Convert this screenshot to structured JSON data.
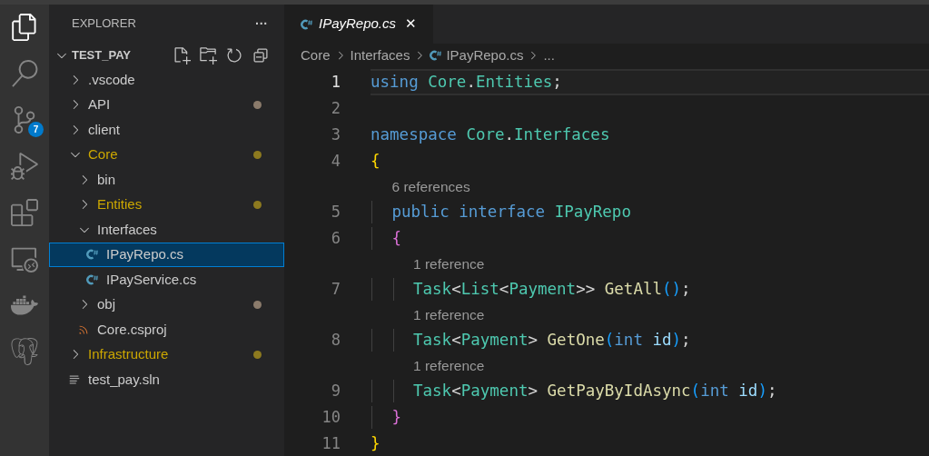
{
  "activity_bar": [
    {
      "kind": "files",
      "selected": true
    },
    {
      "kind": "search",
      "selected": false
    },
    {
      "kind": "source-control",
      "selected": false,
      "badge": "7"
    },
    {
      "kind": "debug",
      "selected": false
    },
    {
      "kind": "extensions",
      "selected": false
    },
    {
      "kind": "remote",
      "selected": false
    },
    {
      "kind": "docker",
      "selected": false
    },
    {
      "kind": "database",
      "selected": false
    }
  ],
  "sidebar": {
    "title": "EXPLORER",
    "more": "···",
    "root": {
      "name": "TEST_PAY",
      "expanded": true
    },
    "items": [
      {
        "name": ".vscode",
        "kind": "folder",
        "expanded": false,
        "modified": false,
        "selected": false
      },
      {
        "name": "API",
        "kind": "folder",
        "expanded": false,
        "modified": false,
        "selected": false,
        "color": "#8b7b6b"
      },
      {
        "name": "client",
        "kind": "folder",
        "expanded": false,
        "modified": false,
        "selected": false
      },
      {
        "name": "Core",
        "kind": "folder",
        "expanded": true,
        "modified": true,
        "selected": false,
        "color": "#8d7a1f",
        "children": [
          {
            "name": "bin",
            "kind": "folder",
            "expanded": false,
            "modified": false,
            "selected": false
          },
          {
            "name": "Entities",
            "kind": "folder",
            "expanded": false,
            "modified": true,
            "selected": false,
            "color": "#8d7a1f"
          },
          {
            "name": "Interfaces",
            "kind": "folder",
            "expanded": true,
            "modified": false,
            "selected": false,
            "children": [
              {
                "name": "IPayRepo.cs",
                "kind": "csharp",
                "modified": false,
                "selected": true
              },
              {
                "name": "IPayService.cs",
                "kind": "csharp",
                "modified": false,
                "selected": false
              }
            ]
          },
          {
            "name": "obj",
            "kind": "folder",
            "expanded": false,
            "modified": false,
            "selected": false,
            "color": "#8b7b6b"
          },
          {
            "name": "Core.csproj",
            "kind": "rss",
            "modified": false,
            "selected": false
          }
        ]
      },
      {
        "name": "Infrastructure",
        "kind": "folder",
        "expanded": false,
        "modified": true,
        "selected": false,
        "color": "#8d7a1f"
      },
      {
        "name": "test_pay.sln",
        "kind": "lines",
        "modified": false,
        "selected": false
      }
    ]
  },
  "tabs": [
    {
      "title": "IPayRepo.cs",
      "preview": true,
      "selected": true,
      "close": "✕"
    }
  ],
  "breadcrumbs": [
    {
      "label": "Core",
      "kind": "folder"
    },
    {
      "label": "Interfaces",
      "kind": "folder"
    },
    {
      "label": "IPayRepo.cs",
      "kind": "csharp"
    },
    {
      "label": "...",
      "kind": "symbol"
    }
  ],
  "lines": [
    {
      "kind": "code",
      "number": "1",
      "current": true,
      "words": [
        [
          {
            "text": "using",
            "kind": "keyword"
          }
        ],
        [
          {
            "text": "Core",
            "kind": "type"
          },
          {
            "text": ".",
            "kind": "plain"
          },
          {
            "text": "Entities",
            "kind": "type"
          },
          {
            "text": ";",
            "kind": "plain"
          }
        ]
      ]
    },
    {
      "kind": "code",
      "number": "2",
      "current": false
    },
    {
      "kind": "code",
      "number": "3",
      "current": false,
      "words": [
        [
          {
            "text": "namespace",
            "kind": "keyword"
          }
        ],
        [
          {
            "text": "Core",
            "kind": "type"
          },
          {
            "text": ".",
            "kind": "plain"
          },
          {
            "text": "Interfaces",
            "kind": "type"
          }
        ]
      ]
    },
    {
      "kind": "code",
      "number": "4",
      "current": false,
      "words": [
        [
          {
            "text": "{",
            "kind": "bracket1"
          }
        ]
      ],
      "children": [
        {
          "kind": "codelens",
          "text": "6 references"
        },
        {
          "kind": "code",
          "number": "5",
          "current": false,
          "words": [
            [
              {
                "text": "public",
                "kind": "keyword"
              }
            ],
            [
              {
                "text": "interface",
                "kind": "keyword"
              }
            ],
            [
              {
                "text": "IPayRepo",
                "kind": "type"
              }
            ]
          ]
        },
        {
          "kind": "code",
          "number": "6",
          "current": false,
          "words": [
            [
              {
                "text": "{",
                "kind": "bracket2"
              }
            ]
          ],
          "children": [
            {
              "kind": "codelens",
              "text": "1 reference"
            },
            {
              "kind": "code",
              "number": "7",
              "current": false,
              "words": [
                [
                  {
                    "text": "Task",
                    "kind": "type"
                  },
                  {
                    "text": "<",
                    "kind": "plain"
                  },
                  {
                    "text": "List",
                    "kind": "type"
                  },
                  {
                    "text": "<",
                    "kind": "plain"
                  },
                  {
                    "text": "Payment",
                    "kind": "type"
                  },
                  {
                    "text": ">>",
                    "kind": "plain"
                  }
                ],
                [
                  {
                    "text": "GetAll",
                    "kind": "func"
                  },
                  {
                    "text": "()",
                    "kind": "bracket3"
                  },
                  {
                    "text": ";",
                    "kind": "plain"
                  }
                ]
              ]
            },
            {
              "kind": "codelens",
              "text": "1 reference"
            },
            {
              "kind": "code",
              "number": "8",
              "current": false,
              "words": [
                [
                  {
                    "text": "Task",
                    "kind": "type"
                  },
                  {
                    "text": "<",
                    "kind": "plain"
                  },
                  {
                    "text": "Payment",
                    "kind": "type"
                  },
                  {
                    "text": ">",
                    "kind": "plain"
                  }
                ],
                [
                  {
                    "text": "GetOne",
                    "kind": "func"
                  },
                  {
                    "text": "(",
                    "kind": "bracket3"
                  },
                  {
                    "text": "int",
                    "kind": "keyword"
                  }
                ],
                [
                  {
                    "text": "id",
                    "kind": "param"
                  },
                  {
                    "text": ")",
                    "kind": "bracket3"
                  },
                  {
                    "text": ";",
                    "kind": "plain"
                  }
                ]
              ]
            },
            {
              "kind": "codelens",
              "text": "1 reference"
            },
            {
              "kind": "code",
              "number": "9",
              "current": false,
              "words": [
                [
                  {
                    "text": "Task",
                    "kind": "type"
                  },
                  {
                    "text": "<",
                    "kind": "plain"
                  },
                  {
                    "text": "Payment",
                    "kind": "type"
                  },
                  {
                    "text": ">",
                    "kind": "plain"
                  }
                ],
                [
                  {
                    "text": "GetPayByIdAsync",
                    "kind": "func"
                  },
                  {
                    "text": "(",
                    "kind": "bracket3"
                  },
                  {
                    "text": "int",
                    "kind": "keyword"
                  }
                ],
                [
                  {
                    "text": "id",
                    "kind": "param"
                  },
                  {
                    "text": ")",
                    "kind": "bracket3"
                  },
                  {
                    "text": ";",
                    "kind": "plain"
                  }
                ]
              ]
            }
          ]
        },
        {
          "kind": "code",
          "number": "10",
          "current": false,
          "words": [
            [
              {
                "text": "}",
                "kind": "bracket2"
              }
            ]
          ]
        }
      ]
    },
    {
      "kind": "code",
      "number": "11",
      "current": false,
      "words": [
        [
          {
            "text": "}",
            "kind": "bracket1"
          }
        ]
      ]
    }
  ]
}
